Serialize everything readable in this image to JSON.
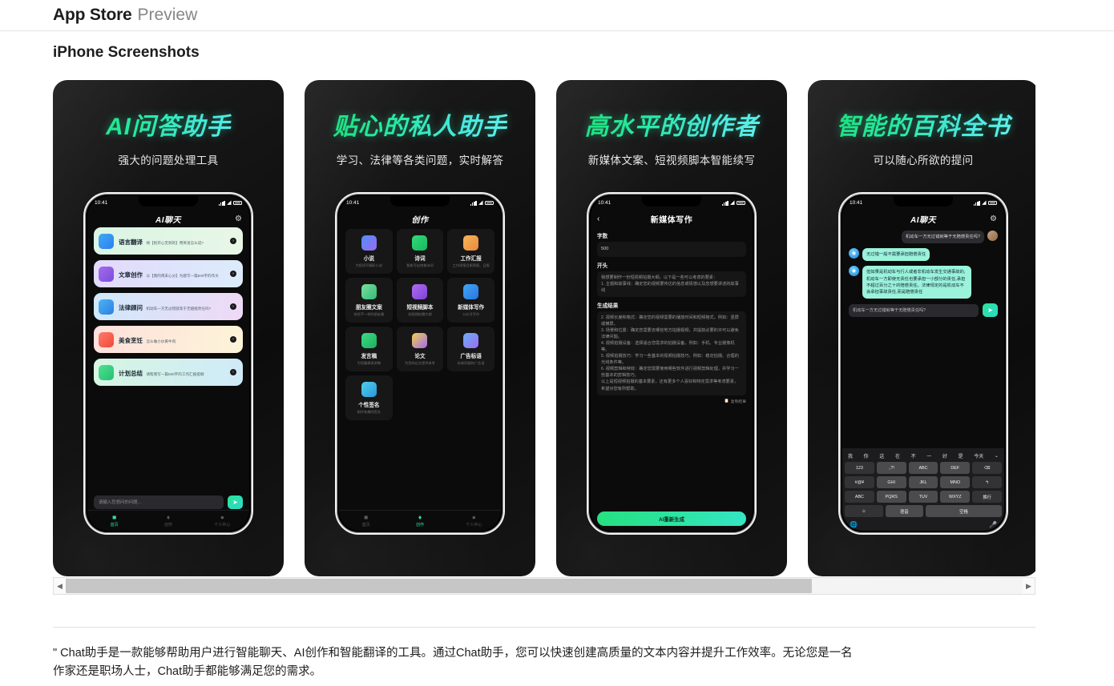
{
  "header": {
    "brand": "App Store",
    "brand_suffix": "Preview",
    "section_title": "iPhone Screenshots"
  },
  "status_bar": {
    "time": "10:41"
  },
  "screenshots": [
    {
      "headline": "AI问答助手",
      "subhead": "强大的问题处理工具",
      "nav_title": "AI聊天",
      "nav_right_icon": "gear-icon",
      "cards": [
        {
          "name": "语言翻译",
          "desc": "将【别开心无到的】用英语怎么说?",
          "icon_colors": [
            "#3fa9f5",
            "#2d7ff0"
          ],
          "bg": [
            "#d9f5e4",
            "#e6f7ea"
          ]
        },
        {
          "name": "文章创作",
          "desc": "以【我的周末心分】为题写一篇500字的作文",
          "icon_colors": [
            "#a36bf0",
            "#7c4dd6"
          ],
          "bg": [
            "#e2d9fb",
            "#dcecfb"
          ]
        },
        {
          "name": "法律顾问",
          "desc": "机动车一方无过错就等于无赔偿责任吗?",
          "icon_colors": [
            "#4ab3f4",
            "#2f7fe0"
          ],
          "bg": [
            "#cfe9fb",
            "#f0d9f6"
          ]
        },
        {
          "name": "美食烹饪",
          "desc": "怎么做小炒黄牛肉",
          "icon_colors": [
            "#ff7a6b",
            "#f0493a"
          ],
          "bg": [
            "#fde0dc",
            "#fdf4d8"
          ]
        },
        {
          "name": "计划总结",
          "desc": "请帮我写一篇500字的工作汇报提纲",
          "icon_colors": [
            "#4fe08f",
            "#27bf73"
          ],
          "bg": [
            "#d6f6e2",
            "#cfeaf8"
          ]
        }
      ],
      "input_placeholder": "请输入您想问的问题...",
      "send_icon": "send-icon",
      "tabs": [
        {
          "label": "首页",
          "icon": "home-icon",
          "active": true
        },
        {
          "label": "创作",
          "icon": "pen-icon",
          "active": false
        },
        {
          "label": "个人中心",
          "icon": "user-icon",
          "active": false
        }
      ]
    },
    {
      "headline": "贴心的私人助手",
      "subhead": "学习、法律等各类问题，实时解答",
      "nav_title": "创作",
      "grid": [
        {
          "name": "小说",
          "desc": "为您续写精彩小说",
          "icon_colors": [
            "#4f8ef7",
            "#9b6bf0"
          ]
        },
        {
          "name": "诗词",
          "desc": "智能写出绝美诗词",
          "icon_colors": [
            "#34d97a",
            "#15b85f"
          ]
        },
        {
          "name": "工作汇报",
          "desc": "工作周报月报周报、日报",
          "icon_colors": [
            "#f7b55a",
            "#e8893a"
          ]
        },
        {
          "name": "朋友圈文案",
          "desc": "体验不一样的朋友圈",
          "icon_colors": [
            "#7ae0a0",
            "#35b877"
          ]
        },
        {
          "name": "短视频脚本",
          "desc": "短视频拍摄大纲",
          "icon_colors": [
            "#b06bf0",
            "#7d43d6"
          ]
        },
        {
          "name": "新媒体写作",
          "desc": "公众号写作",
          "icon_colors": [
            "#3fa9f5",
            "#2a73e0"
          ]
        },
        {
          "name": "发言稿",
          "desc": "为您编辑演讲稿",
          "icon_colors": [
            "#3ddc84",
            "#1fae62"
          ]
        },
        {
          "name": "论文",
          "desc": "为您的论文提供参考",
          "icon_colors": [
            "#f0d04a",
            "#a36bf0"
          ]
        },
        {
          "name": "广告标语",
          "desc": "标新同颖的广告语",
          "icon_colors": [
            "#6bb0f7",
            "#9b6bf0"
          ]
        },
        {
          "name": "个性签名",
          "desc": "制作有趣的签名",
          "icon_colors": [
            "#4fd0f0",
            "#2a96d6"
          ]
        }
      ],
      "tabs": [
        {
          "label": "首页",
          "icon": "home-icon",
          "active": false
        },
        {
          "label": "创作",
          "icon": "pen-icon",
          "active": true
        },
        {
          "label": "个人中心",
          "icon": "user-icon",
          "active": false
        }
      ]
    },
    {
      "headline": "高水平的创作者",
      "subhead": "新媒体文案、短视频脚本智能续写",
      "nav_title": "新媒体写作",
      "nav_left_icon": "back-chevron-icon",
      "form": {
        "count_label": "字数",
        "count_value": "500",
        "start_label": "开头",
        "start_text": "我想要制作一份短视频拍摄大纲，以下是一些可以考虑的要素：\n1. 主题和故事线：确定您的视频要传达的信息或情感以及您想要讲述的故事线",
        "result_label": "生成结果",
        "result_text": "2. 视频长度和格式：确定您的视频需要的播放时间和短频格式，例如：竖屏或横屏。\n3. 场景和位置：确定您需要去哪些地方拍摄视频，并提前必要的许可以避免法律问题。\n4. 视频拍摄设备：选择适合您需求的拍摄设备，例如：手机、专业摄像机等。\n5. 视频拍摄技巧：学习一些基本的视频拍摄技巧，例如：稳定拍摄、合理的光线条件等。\n6. 视频剪辑和特效：确定您需要使用哪些软件进行视频剪辑处理，并学习一些基本的剪辑技巧。\n以上是短视频拍摄的基本要素，还有更多个人喜好和特定需求等考虑要素，希望对您有所帮助。",
        "copy_label": "复制结果",
        "copy_icon": "copy-icon",
        "generate_button": "AI重新生成"
      }
    },
    {
      "headline": "智能的百科全书",
      "subhead": "可以随心所欲的提问",
      "nav_title": "AI聊天",
      "nav_right_icon": "gear-icon",
      "messages": [
        {
          "from": "me",
          "text": "机动车一方无过错就等于无赔偿责任吗?"
        },
        {
          "from": "ai",
          "text": "无过错一般不需要承担赔偿责任"
        },
        {
          "from": "ai",
          "text": "但如果是机动车与行人或者非机动车发生交通事故的,机动车一方即使无责任也要承担一小部分的责任,承担不超过百分之十的赔偿责任。法律规定的是机动车不会承担事故责任,而是赔偿责任"
        }
      ],
      "input_value": "机动车一方无过错就等于无赔偿责任吗?",
      "send_icon": "send-icon",
      "keyboard": {
        "suggestions": [
          "我",
          "你",
          "这",
          "在",
          "不",
          "一",
          "好",
          "是",
          "今天"
        ],
        "expand_icon": "chevron-down-icon",
        "rows": [
          [
            "123",
            ".,?!",
            "ABC",
            "DEF",
            "⌫"
          ],
          [
            "#@¥",
            "GHI",
            "JKL",
            "MNO",
            "↰"
          ],
          [
            "ABC",
            "PQRS",
            "TUV",
            "WXYZ",
            "换行"
          ],
          [
            "☺",
            "语音",
            "空格"
          ]
        ],
        "globe_icon": "globe-icon",
        "mic_icon": "microphone-icon"
      }
    }
  ],
  "scrollbar": {
    "left_arrow": "◀",
    "right_arrow": "▶",
    "thumb_percent": 78
  },
  "description": "\" Chat助手是一款能够帮助用户进行智能聊天、AI创作和智能翻译的工具。通过Chat助手，您可以快速创建高质量的文本内容并提升工作效率。无论您是一名作家还是职场人士，Chat助手都能够满足您的需求。"
}
